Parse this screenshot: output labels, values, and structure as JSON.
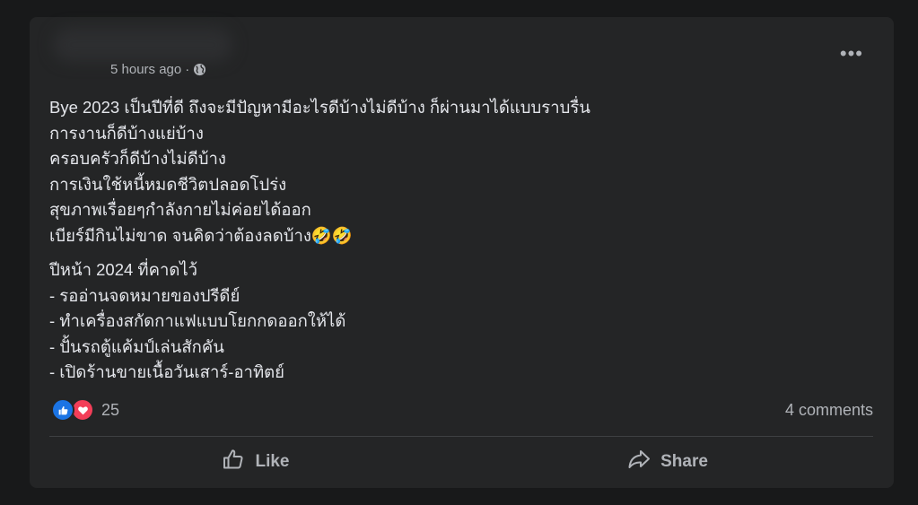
{
  "post": {
    "timestamp": "5 hours ago",
    "separator": "·",
    "audience_icon": "globe-icon",
    "more_label": "•••",
    "paragraphs": [
      [
        "Bye 2023 เป็นปีที่ดี ถึงจะมีปัญหามีอะไรดีบ้างไม่ดีบ้าง ก็ผ่านมาได้แบบราบรื่น",
        "การงานก็ดีบ้างแย่บ้าง",
        "ครอบครัวก็ดีบ้างไม่ดีบ้าง",
        "การเงินใช้หนี้หมดชีวิตปลอดโปร่ง",
        "สุขภาพเรื่อยๆกำลังกายไม่ค่อยได้ออก",
        "เบียร์มีกินไม่ขาด จนคิดว่าต้องลดบ้าง🤣🤣"
      ],
      [
        "ปีหน้า 2024 ที่คาดไว้",
        "- รออ่านจดหมายของปรีดีย์",
        "- ทำเครื่องสกัดกาแฟแบบโยกกดออกให้ได้",
        "- ปั้นรถตู้แค้มป์เล่นสักคัน",
        "- เปิดร้านขายเนื้อวันเสาร์-อาทิตย์"
      ]
    ]
  },
  "reactions": {
    "icons": [
      "like-reaction-icon",
      "love-reaction-icon"
    ],
    "count": "25",
    "comments": "4 comments",
    "colors": {
      "like": "#1b74e4",
      "love": "#f33e58"
    }
  },
  "actions": {
    "like_label": "Like",
    "share_label": "Share"
  }
}
